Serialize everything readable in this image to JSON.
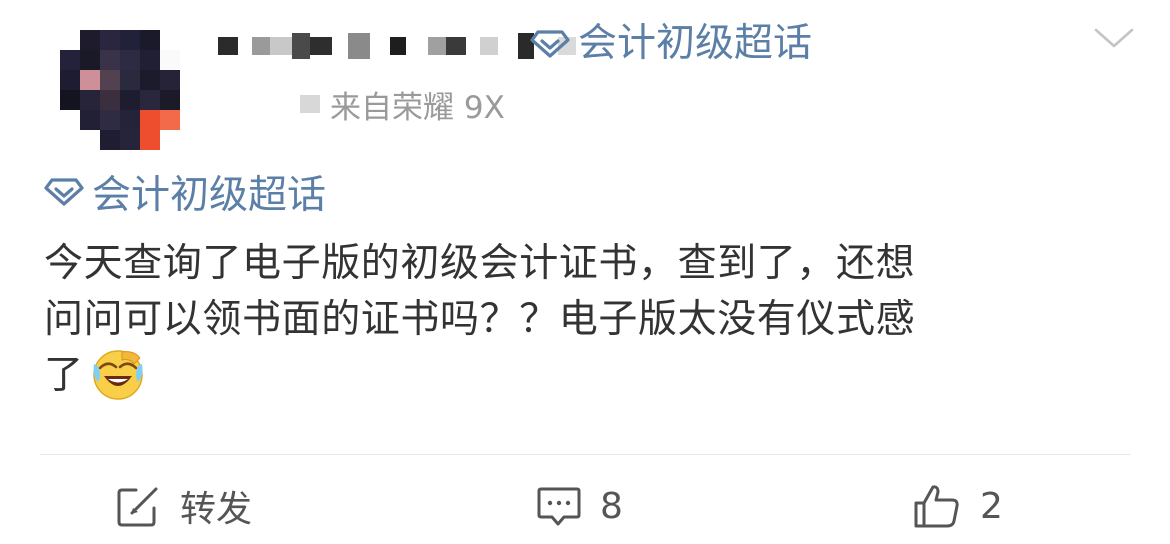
{
  "header": {
    "username_censored": true,
    "topic_tag": "会计初级超话",
    "source": "来自荣耀 9X"
  },
  "post": {
    "topic": "会计初级超话",
    "lines": [
      "今天查询了电子版的初级会计证书，查到了，还想",
      "问问可以领书面的证书吗？？电子版太没有仪式感",
      "了"
    ],
    "emoji": "laugh-cry-emoji"
  },
  "actions": {
    "repost_label": "转发",
    "comment_count": "8",
    "like_count": "2"
  },
  "colors": {
    "topic": "#5b7fa6",
    "text": "#333333",
    "secondary": "#9a9a9a",
    "divider": "#e6e6e6"
  }
}
